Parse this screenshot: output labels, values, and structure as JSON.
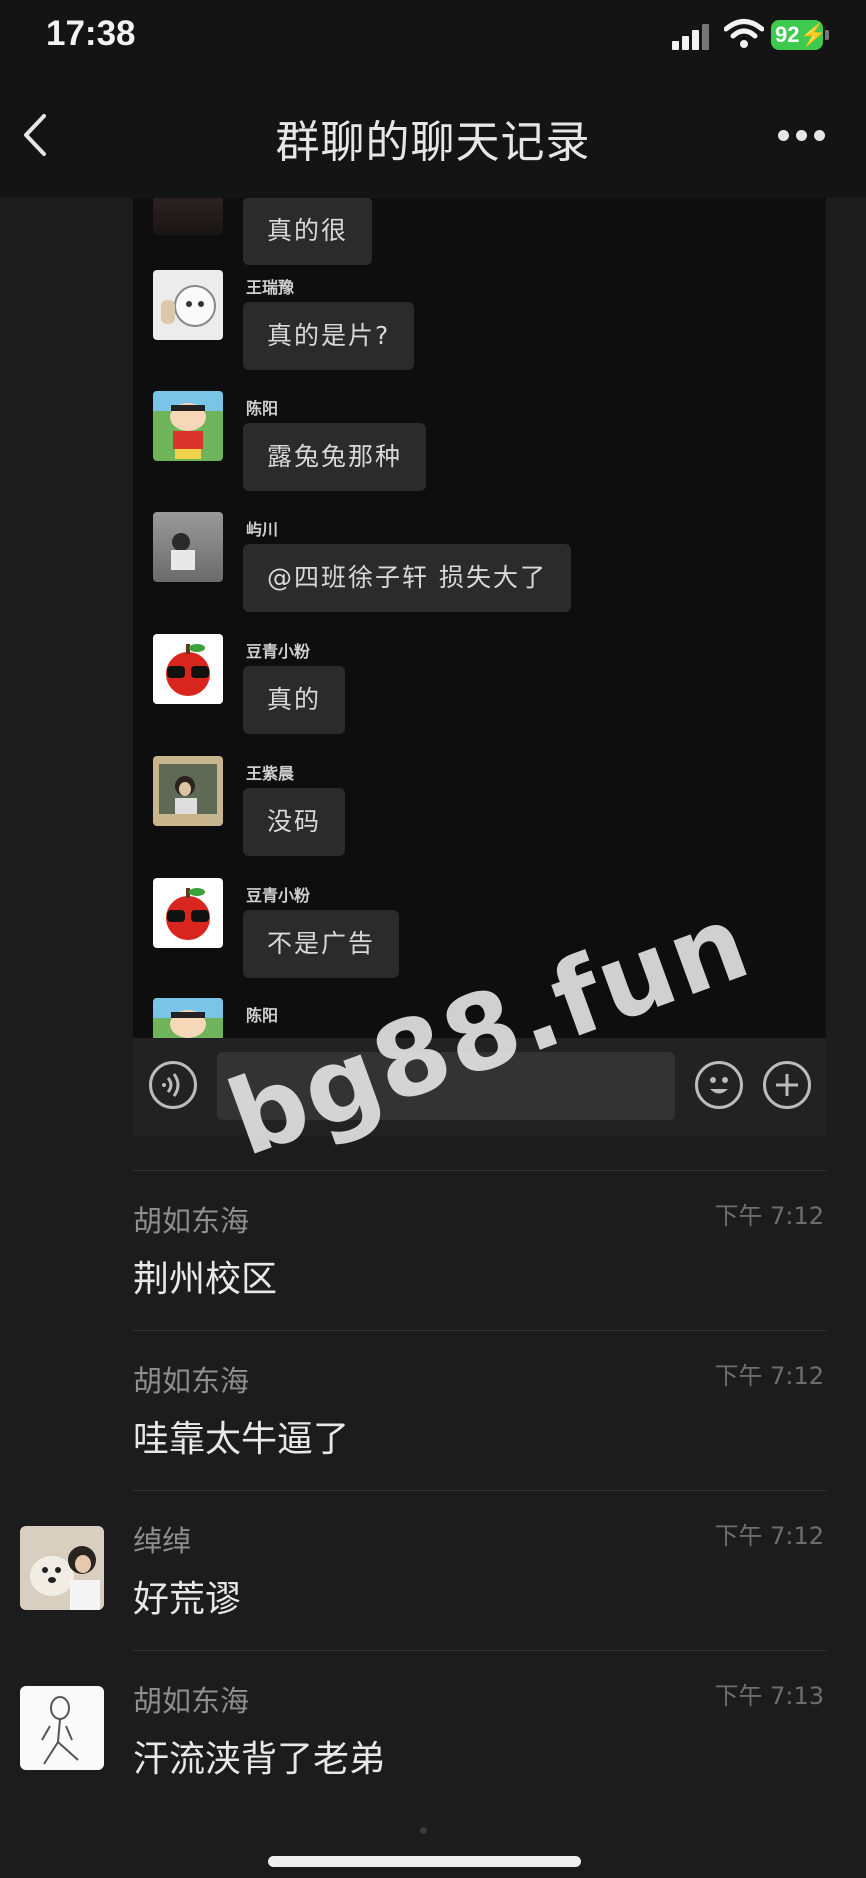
{
  "status_bar": {
    "time": "17:38",
    "battery": "92"
  },
  "nav": {
    "title": "群聊的聊天记录"
  },
  "screenshot": {
    "messages": [
      {
        "sender": "",
        "text": "真的很",
        "avatar": "dark-photo-avatar"
      },
      {
        "sender": "王瑞豫",
        "text": "真的是片?",
        "avatar": "doll-avatar"
      },
      {
        "sender": "陈阳",
        "text": "露兔兔那种",
        "avatar": "crayon-shin-chan-avatar"
      },
      {
        "sender": "屿川",
        "text": "@四班徐子轩  损失大了",
        "avatar": "person-photo-avatar"
      },
      {
        "sender": "豆青小粉",
        "text": "真的",
        "avatar": "apple-sunglasses-avatar"
      },
      {
        "sender": "王紫晨",
        "text": "没码",
        "avatar": "girl-photo-avatar"
      },
      {
        "sender": "豆青小粉",
        "text": "不是广告",
        "avatar": "apple-sunglasses-avatar"
      },
      {
        "sender": "陈阳",
        "text": "",
        "avatar": "crayon-shin-chan-avatar"
      }
    ]
  },
  "watermark": "bg88.fun",
  "comments": [
    {
      "name": "胡如东海",
      "time": "下午 7:12",
      "text": "荆州校区",
      "avatar": ""
    },
    {
      "name": "胡如东海",
      "time": "下午 7:12",
      "text": "哇靠太牛逼了",
      "avatar": ""
    },
    {
      "name": "绰绰",
      "time": "下午 7:12",
      "text": "好荒谬",
      "avatar": "dog-and-girl-photo-avatar"
    },
    {
      "name": "胡如东海",
      "time": "下午 7:13",
      "text": "汗流浃背了老弟",
      "avatar": "sketch-figure-avatar"
    }
  ],
  "colors": {
    "background": "#1c1c1c",
    "bubble": "#2b2b2b",
    "battery": "#3ec94f"
  }
}
